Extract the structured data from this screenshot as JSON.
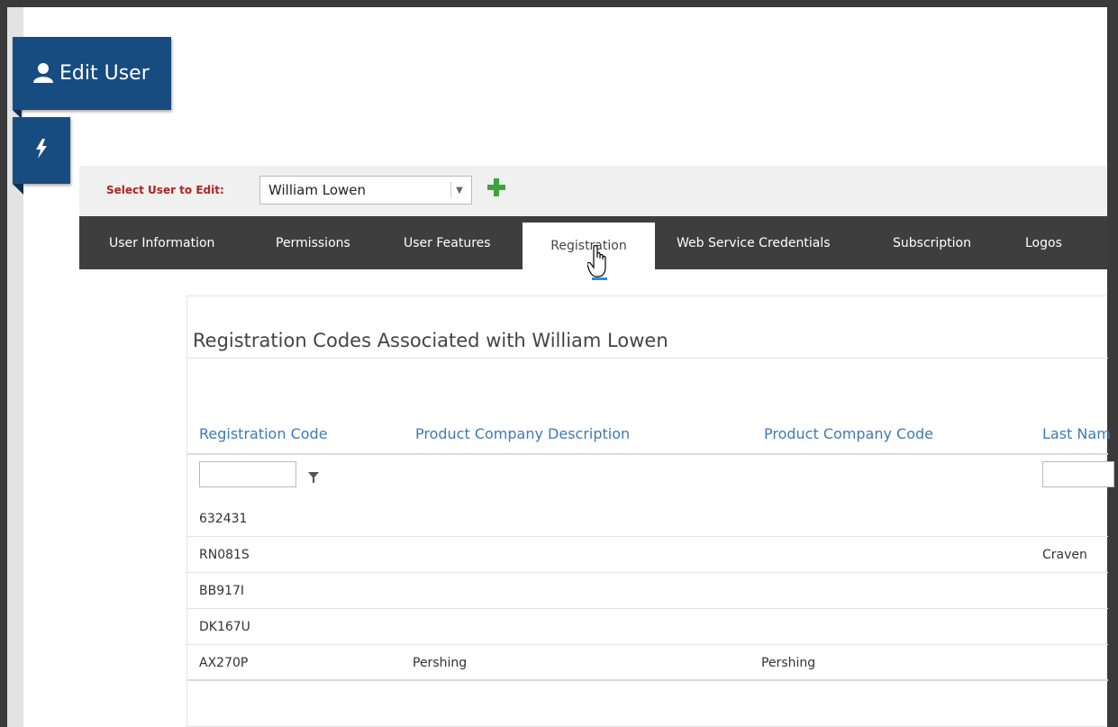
{
  "sidebar": {
    "edit_user_title": "Edit User",
    "user_icon": "user-icon",
    "bolt_icon": "lightning-bolt-icon"
  },
  "select_user": {
    "label": "Select User to Edit:",
    "value": "William Lowen",
    "dropdown_icon": "chevron-down-icon",
    "add_icon": "plus-icon"
  },
  "tabs": [
    {
      "label": "User Information"
    },
    {
      "label": "Permissions"
    },
    {
      "label": "User Features"
    },
    {
      "label": "Registration",
      "active": true
    },
    {
      "label": "Web Service Credentials"
    },
    {
      "label": "Subscription"
    },
    {
      "label": "Logos"
    }
  ],
  "panel": {
    "title": "Registration Codes Associated with William Lowen",
    "columns": [
      "Registration Code",
      "Product Company Description",
      "Product Company Code",
      "Last Nam"
    ],
    "filter_icon": "filter-icon",
    "rows": [
      {
        "code": "632431",
        "desc": "",
        "company_code": "",
        "last_name": ""
      },
      {
        "code": "RN081S",
        "desc": "",
        "company_code": "",
        "last_name": "Craven"
      },
      {
        "code": "BB917I",
        "desc": "",
        "company_code": "",
        "last_name": ""
      },
      {
        "code": "DK167U",
        "desc": "",
        "company_code": "",
        "last_name": ""
      },
      {
        "code": "AX270P",
        "desc": "Pershing",
        "company_code": "Pershing",
        "last_name": ""
      }
    ]
  },
  "colors": {
    "brand_blue": "#174c80",
    "tab_bar": "#3e3e3e",
    "label_red": "#b22222",
    "link_blue": "#3d7ab8",
    "add_green": "#3aa63a"
  }
}
